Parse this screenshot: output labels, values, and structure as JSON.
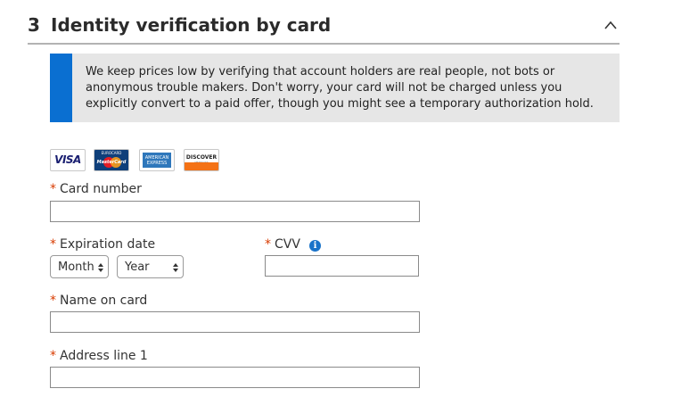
{
  "section": {
    "step_number": "3",
    "title": "Identity verification by card"
  },
  "info": {
    "text": "We keep prices low by verifying that account holders are real people, not bots or anonymous trouble makers. Don't worry, your card will not be charged unless you explicitly convert to a paid offer, though you might see a temporary authorization hold."
  },
  "card_logos": {
    "visa": "VISA",
    "mastercard_top": "EUROCARD",
    "mastercard": "MasterCard",
    "amex_line1": "AMERICAN",
    "amex_line2": "EXPRESS",
    "discover": "DISCOVER",
    "discover_sub": "NETWORK"
  },
  "form": {
    "required_marker": "*",
    "card_number_label": "Card number",
    "card_number_value": "",
    "expiration_label": "Expiration date",
    "month_value": "Month",
    "year_value": "Year",
    "cvv_label": "CVV",
    "cvv_value": "",
    "name_label": "Name on card",
    "name_value": "",
    "address_label": "Address line 1",
    "address_value": ""
  },
  "icons": {
    "collapse": "chevron-up-icon",
    "info": "info-icon",
    "info_glyph": "i"
  },
  "colors": {
    "accent": "#0a6fd1",
    "required": "#d83b01",
    "info_bg": "#e6e6e6"
  }
}
